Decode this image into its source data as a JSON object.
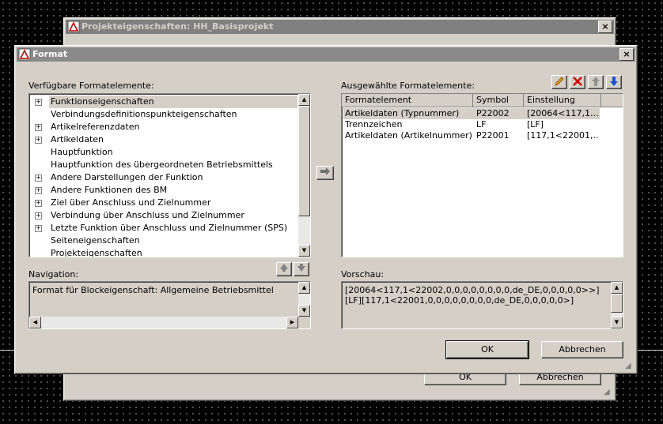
{
  "background_window": {
    "title": "Projekteigenschaften: HH_Basisprojekt",
    "close_label": "×",
    "ok_label": "OK",
    "cancel_label": "Abbrechen"
  },
  "dialog": {
    "title": "Format",
    "close_label": "×",
    "available_label": "Verfügbare Formatelemente:",
    "available_items": [
      {
        "label": "Funktionseigenschaften",
        "expandable": true,
        "selected": true
      },
      {
        "label": "Verbindungsdefinitionspunkteigenschaften",
        "expandable": false
      },
      {
        "label": "Artikelreferenzdaten",
        "expandable": true
      },
      {
        "label": "Artikeldaten",
        "expandable": true
      },
      {
        "label": "Hauptfunktion",
        "expandable": false
      },
      {
        "label": "Hauptfunktion des übergeordneten Betriebsmittels",
        "expandable": false
      },
      {
        "label": "Andere Darstellungen der Funktion",
        "expandable": true
      },
      {
        "label": "Andere Funktionen des BM",
        "expandable": true
      },
      {
        "label": "Ziel über Anschluss und Zielnummer",
        "expandable": true
      },
      {
        "label": "Verbindung über Anschluss und Zielnummer",
        "expandable": true
      },
      {
        "label": "Letzte Funktion über Anschluss und Zielnummer (SPS)",
        "expandable": true
      },
      {
        "label": "Seiteneigenschaften",
        "expandable": false
      },
      {
        "label": "Projekteigenschaften",
        "expandable": false
      }
    ],
    "selected_label": "Ausgewählte Formatelemente:",
    "columns": [
      "Formatelement",
      "Symbol",
      "Einstellung"
    ],
    "rows": [
      {
        "element": "Artikeldaten (Typnummer)",
        "symbol": "P22002",
        "setting": "[20064<117,1...",
        "selected": true
      },
      {
        "element": "Trennzeichen",
        "symbol": "LF",
        "setting": "[LF]"
      },
      {
        "element": "Artikeldaten (Artikelnummer)",
        "symbol": "P22001",
        "setting": "[117,1<22001,..."
      }
    ],
    "navigation_label": "Navigation:",
    "navigation_text": "Format für Blockeigenschaft: Allgemeine Betriebsmittel",
    "preview_label": "Vorschau:",
    "preview_text": "[20064<117,1<22002,0,0,0,0,0,0,0,0,de_DE,0,0,0,0,0>>][LF][117,1<22001,0,0,0,0,0,0,0,0,de_DE,0,0,0,0,0>]",
    "ok_label": "OK",
    "cancel_label": "Abbrechen"
  },
  "icons": {
    "edit": "pencil-icon",
    "delete": "delete-x-icon",
    "up": "arrow-up-icon",
    "down": "arrow-down-icon",
    "transfer": "arrow-right-icon",
    "accent_red": "#cc0000",
    "accent_blue": "#1a4fd6"
  }
}
